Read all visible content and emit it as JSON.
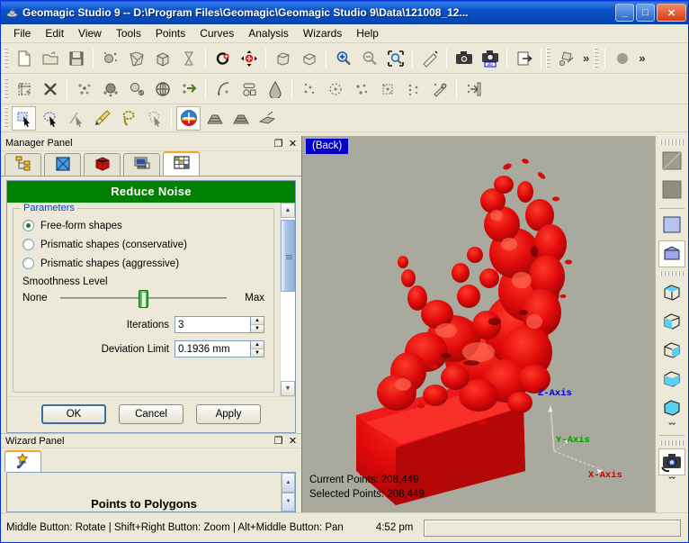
{
  "window": {
    "title": "Geomagic Studio 9 -- D:\\Program Files\\Geomagic\\Geomagic Studio 9\\Data\\121008_12...",
    "app_icon": "geomagic-logo-icon",
    "minimize_label": "_",
    "maximize_label": "□",
    "close_label": "✕"
  },
  "menubar": {
    "items": [
      {
        "label": "File",
        "accel": "F"
      },
      {
        "label": "Edit",
        "accel": "E"
      },
      {
        "label": "View",
        "accel": "V"
      },
      {
        "label": "Tools",
        "accel": "T"
      },
      {
        "label": "Points",
        "accel": "P"
      },
      {
        "label": "Curves",
        "accel": "u"
      },
      {
        "label": "Analysis",
        "accel": "A"
      },
      {
        "label": "Wizards",
        "accel": "W"
      },
      {
        "label": "Help",
        "accel": "H"
      }
    ]
  },
  "toolbar_row1": {
    "overflow_label": "»",
    "buttons": [
      {
        "name": "new-document-icon"
      },
      {
        "name": "open-folder-icon"
      },
      {
        "name": "save-disk-icon"
      },
      {
        "name": "point-cloud-icon"
      },
      {
        "name": "wrap-polygon-icon"
      },
      {
        "name": "cube-shape-icon"
      },
      {
        "name": "hourglass-icon"
      },
      {
        "name": "rotate-icon"
      },
      {
        "name": "move-icon"
      },
      {
        "name": "box-solid-icon"
      },
      {
        "name": "box-open-icon"
      },
      {
        "name": "zoom-in-icon"
      },
      {
        "name": "zoom-out-icon"
      },
      {
        "name": "zoom-fit-icon"
      },
      {
        "name": "measure-ruler-icon"
      },
      {
        "name": "camera-icon"
      },
      {
        "name": "camera-abc-icon"
      },
      {
        "name": "export-icon"
      },
      {
        "name": "shape-tools-icon"
      },
      {
        "name": "sphere-gray-icon"
      }
    ]
  },
  "toolbar_row2": {
    "buttons": [
      {
        "name": "crop-icon"
      },
      {
        "name": "delete-x-icon"
      },
      {
        "name": "scatter-points-icon"
      },
      {
        "name": "noise-cloud-icon"
      },
      {
        "name": "sample-points-icon"
      },
      {
        "name": "globe-grid-icon"
      },
      {
        "name": "transform-points-icon"
      },
      {
        "name": "curve-tool-icon"
      },
      {
        "name": "primitive-shapes-icon"
      },
      {
        "name": "fill-cone-icon"
      },
      {
        "name": "select-scatter-icon"
      },
      {
        "name": "lasso-points-icon"
      },
      {
        "name": "disconnected-points-icon"
      },
      {
        "name": "grid-points-icon"
      },
      {
        "name": "trim-points-icon"
      },
      {
        "name": "eyedropper-points-icon"
      },
      {
        "name": "export-points-icon"
      }
    ]
  },
  "toolbar_row3": {
    "buttons": [
      {
        "name": "rectangle-select-icon",
        "selected": true
      },
      {
        "name": "ellipse-select-icon"
      },
      {
        "name": "line-select-icon"
      },
      {
        "name": "paint-select-icon"
      },
      {
        "name": "lasso-select-icon"
      },
      {
        "name": "polygon-select-icon"
      },
      {
        "name": "shade-color-icon",
        "selected": true
      },
      {
        "name": "view-front-icon"
      },
      {
        "name": "view-back-icon"
      },
      {
        "name": "view-plane-icon"
      }
    ]
  },
  "manager_panel": {
    "title": "Manager Panel",
    "restore_label": "❐",
    "close_label": "✕",
    "tabs": [
      {
        "name": "model-tree-tab",
        "icon": "tree-hierarchy-icon",
        "active": false
      },
      {
        "name": "display-tab",
        "icon": "blue-cube-icon",
        "active": false
      },
      {
        "name": "points-tab",
        "icon": "red-brick-cube-icon",
        "active": false
      },
      {
        "name": "system-tab",
        "icon": "computer-monitor-icon",
        "active": false
      },
      {
        "name": "dialog-tab",
        "icon": "grid-table-icon",
        "active": true
      }
    ]
  },
  "reduce_noise": {
    "title": "Reduce Noise",
    "group_label": "Parameters",
    "options": [
      {
        "label": "Free-form shapes",
        "selected": true
      },
      {
        "label": "Prismatic shapes (conservative)",
        "selected": false
      },
      {
        "label": "Prismatic shapes (aggressive)",
        "selected": false
      }
    ],
    "smoothness_label": "Smoothness Level",
    "slider_min_label": "None",
    "slider_max_label": "Max",
    "slider_percent": 47,
    "iterations_label": "Iterations",
    "iterations_value": "3",
    "deviation_label": "Deviation Limit",
    "deviation_value": "0.1936 mm",
    "buttons": {
      "ok": "OK",
      "cancel": "Cancel",
      "apply": "Apply"
    }
  },
  "wizard_panel": {
    "title": "Wizard Panel",
    "restore_label": "❐",
    "close_label": "✕",
    "tab_icon": "wizard-wand-icon",
    "heading": "Points to Polygons"
  },
  "viewport": {
    "view_label": "(Back)",
    "background_color": "#a9a99d",
    "model_color": "#e00000",
    "current_points_label": "Current Points: 208,449",
    "selected_points_label": "Selected Points: 208,449",
    "axes": {
      "x_label": "X-Axis",
      "x_color": "#d40000",
      "y_label": "Y-Axis",
      "y_color": "#00a000",
      "z_label": "Z-Axis",
      "z_color": "#0000c8"
    }
  },
  "right_toolbar": {
    "chevron_label": "ˇˇ",
    "buttons": [
      {
        "name": "shade-flat-icon"
      },
      {
        "name": "shade-smooth-icon"
      },
      {
        "name": "flat-blue-square-icon"
      },
      {
        "name": "solid-blue-cube-icon",
        "selected": true
      },
      {
        "name": "cube-top-face-icon"
      },
      {
        "name": "cube-front-face-icon"
      },
      {
        "name": "cube-bottom-face-icon"
      },
      {
        "name": "cube-left-face-icon"
      },
      {
        "name": "cube-right-face-icon"
      },
      {
        "name": "cube-solid-face-icon"
      },
      {
        "name": "camera-view-icon"
      }
    ]
  },
  "statusbar": {
    "hint": "Middle Button: Rotate | Shift+Right Button: Zoom | Alt+Middle Button: Pan",
    "time": "4:52 pm"
  }
}
